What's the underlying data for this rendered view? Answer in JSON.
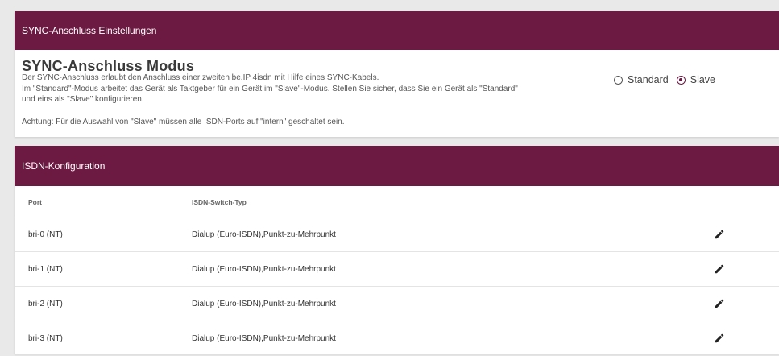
{
  "sync_panel": {
    "header": "SYNC-Anschluss Einstellungen",
    "title": "SYNC-Anschluss Modus",
    "desc_line1": "Der SYNC-Anschluss erlaubt den Anschluss einer zweiten be.IP 4isdn mit Hilfe eines SYNC-Kabels.",
    "desc_line2": "Im \"Standard\"-Modus arbeitet das Gerät als Taktgeber für ein Gerät im \"Slave\"-Modus. Stellen Sie sicher, dass Sie ein Gerät als \"Standard\" und eins als \"Slave\" konfigurieren.",
    "warning": "Achtung: Für die Auswahl von \"Slave\" müssen alle ISDN-Ports auf \"intern\" geschaltet sein.",
    "mode_options": [
      {
        "label": "Standard",
        "selected": false
      },
      {
        "label": "Slave",
        "selected": true
      }
    ]
  },
  "isdn_panel": {
    "header": "ISDN-Konfiguration",
    "columns": {
      "port": "Port",
      "type": "ISDN-Switch-Typ"
    },
    "rows": [
      {
        "port": "bri-0 (NT)",
        "type": "Dialup (Euro-ISDN),Punkt-zu-Mehrpunkt"
      },
      {
        "port": "bri-1 (NT)",
        "type": "Dialup (Euro-ISDN),Punkt-zu-Mehrpunkt"
      },
      {
        "port": "bri-2 (NT)",
        "type": "Dialup (Euro-ISDN),Punkt-zu-Mehrpunkt"
      },
      {
        "port": "bri-3 (NT)",
        "type": "Dialup (Euro-ISDN),Punkt-zu-Mehrpunkt"
      }
    ]
  },
  "colors": {
    "header_bg": "#6d1a42",
    "page_bg": "#e9e9e9"
  },
  "icons": {
    "edit": "pencil-icon"
  }
}
